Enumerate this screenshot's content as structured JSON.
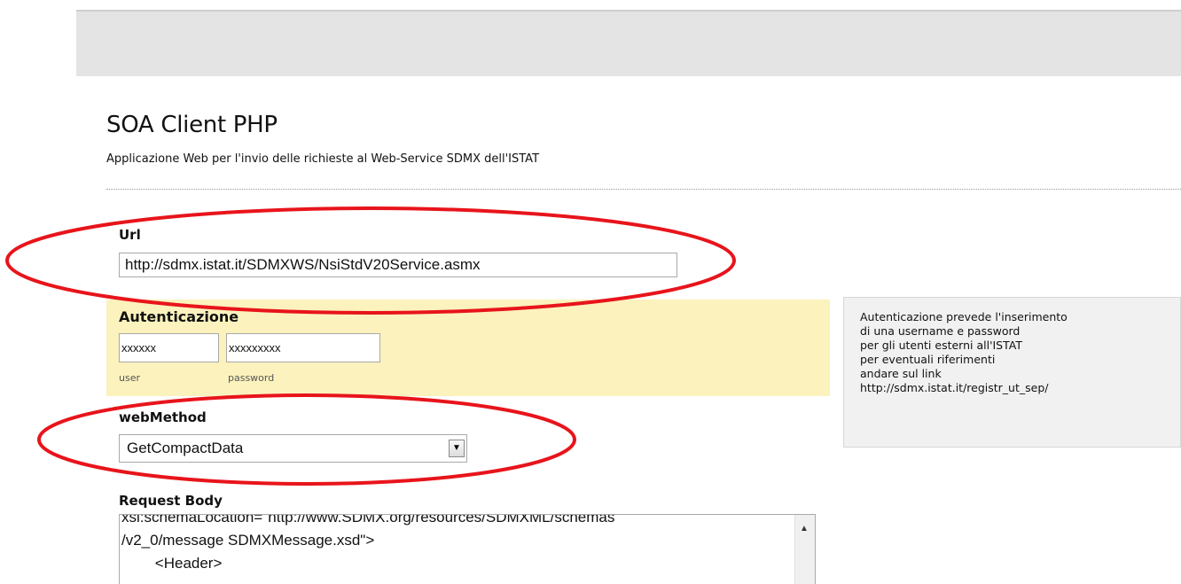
{
  "page": {
    "title": "SOA Client PHP",
    "subtitle": "Applicazione Web per l'invio delle richieste al Web-Service SDMX dell'ISTAT"
  },
  "url_field": {
    "label": "Url",
    "value": "http://sdmx.istat.it/SDMXWS/NsiStdV20Service.asmx"
  },
  "auth": {
    "label": "Autenticazione",
    "user_value": "xxxxxx",
    "password_value": "xxxxxxxxx",
    "user_label": "user",
    "password_label": "password"
  },
  "info": {
    "lines": [
      "Autenticazione prevede l'inserimento",
      "di una username e password",
      "per gli utenti esterni all'ISTAT",
      "per eventuali riferimenti",
      "andare sul link",
      "http://sdmx.istat.it/registr_ut_sep/"
    ]
  },
  "web_method": {
    "label": "webMethod",
    "selected": "GetCompactData",
    "arrow_icon": "chevron-down-icon"
  },
  "request_body": {
    "label": "Request Body",
    "lines": [
      "xsi:schemaLocation=\"http://www.SDMX.org/resources/SDMXML/schemas",
      "/v2_0/message SDMXMessage.xsd\">",
      "        <Header>"
    ]
  },
  "colors": {
    "annotation": "#e8141b",
    "auth_background": "#fbf2bd",
    "topbar": "#e4e4e4"
  }
}
